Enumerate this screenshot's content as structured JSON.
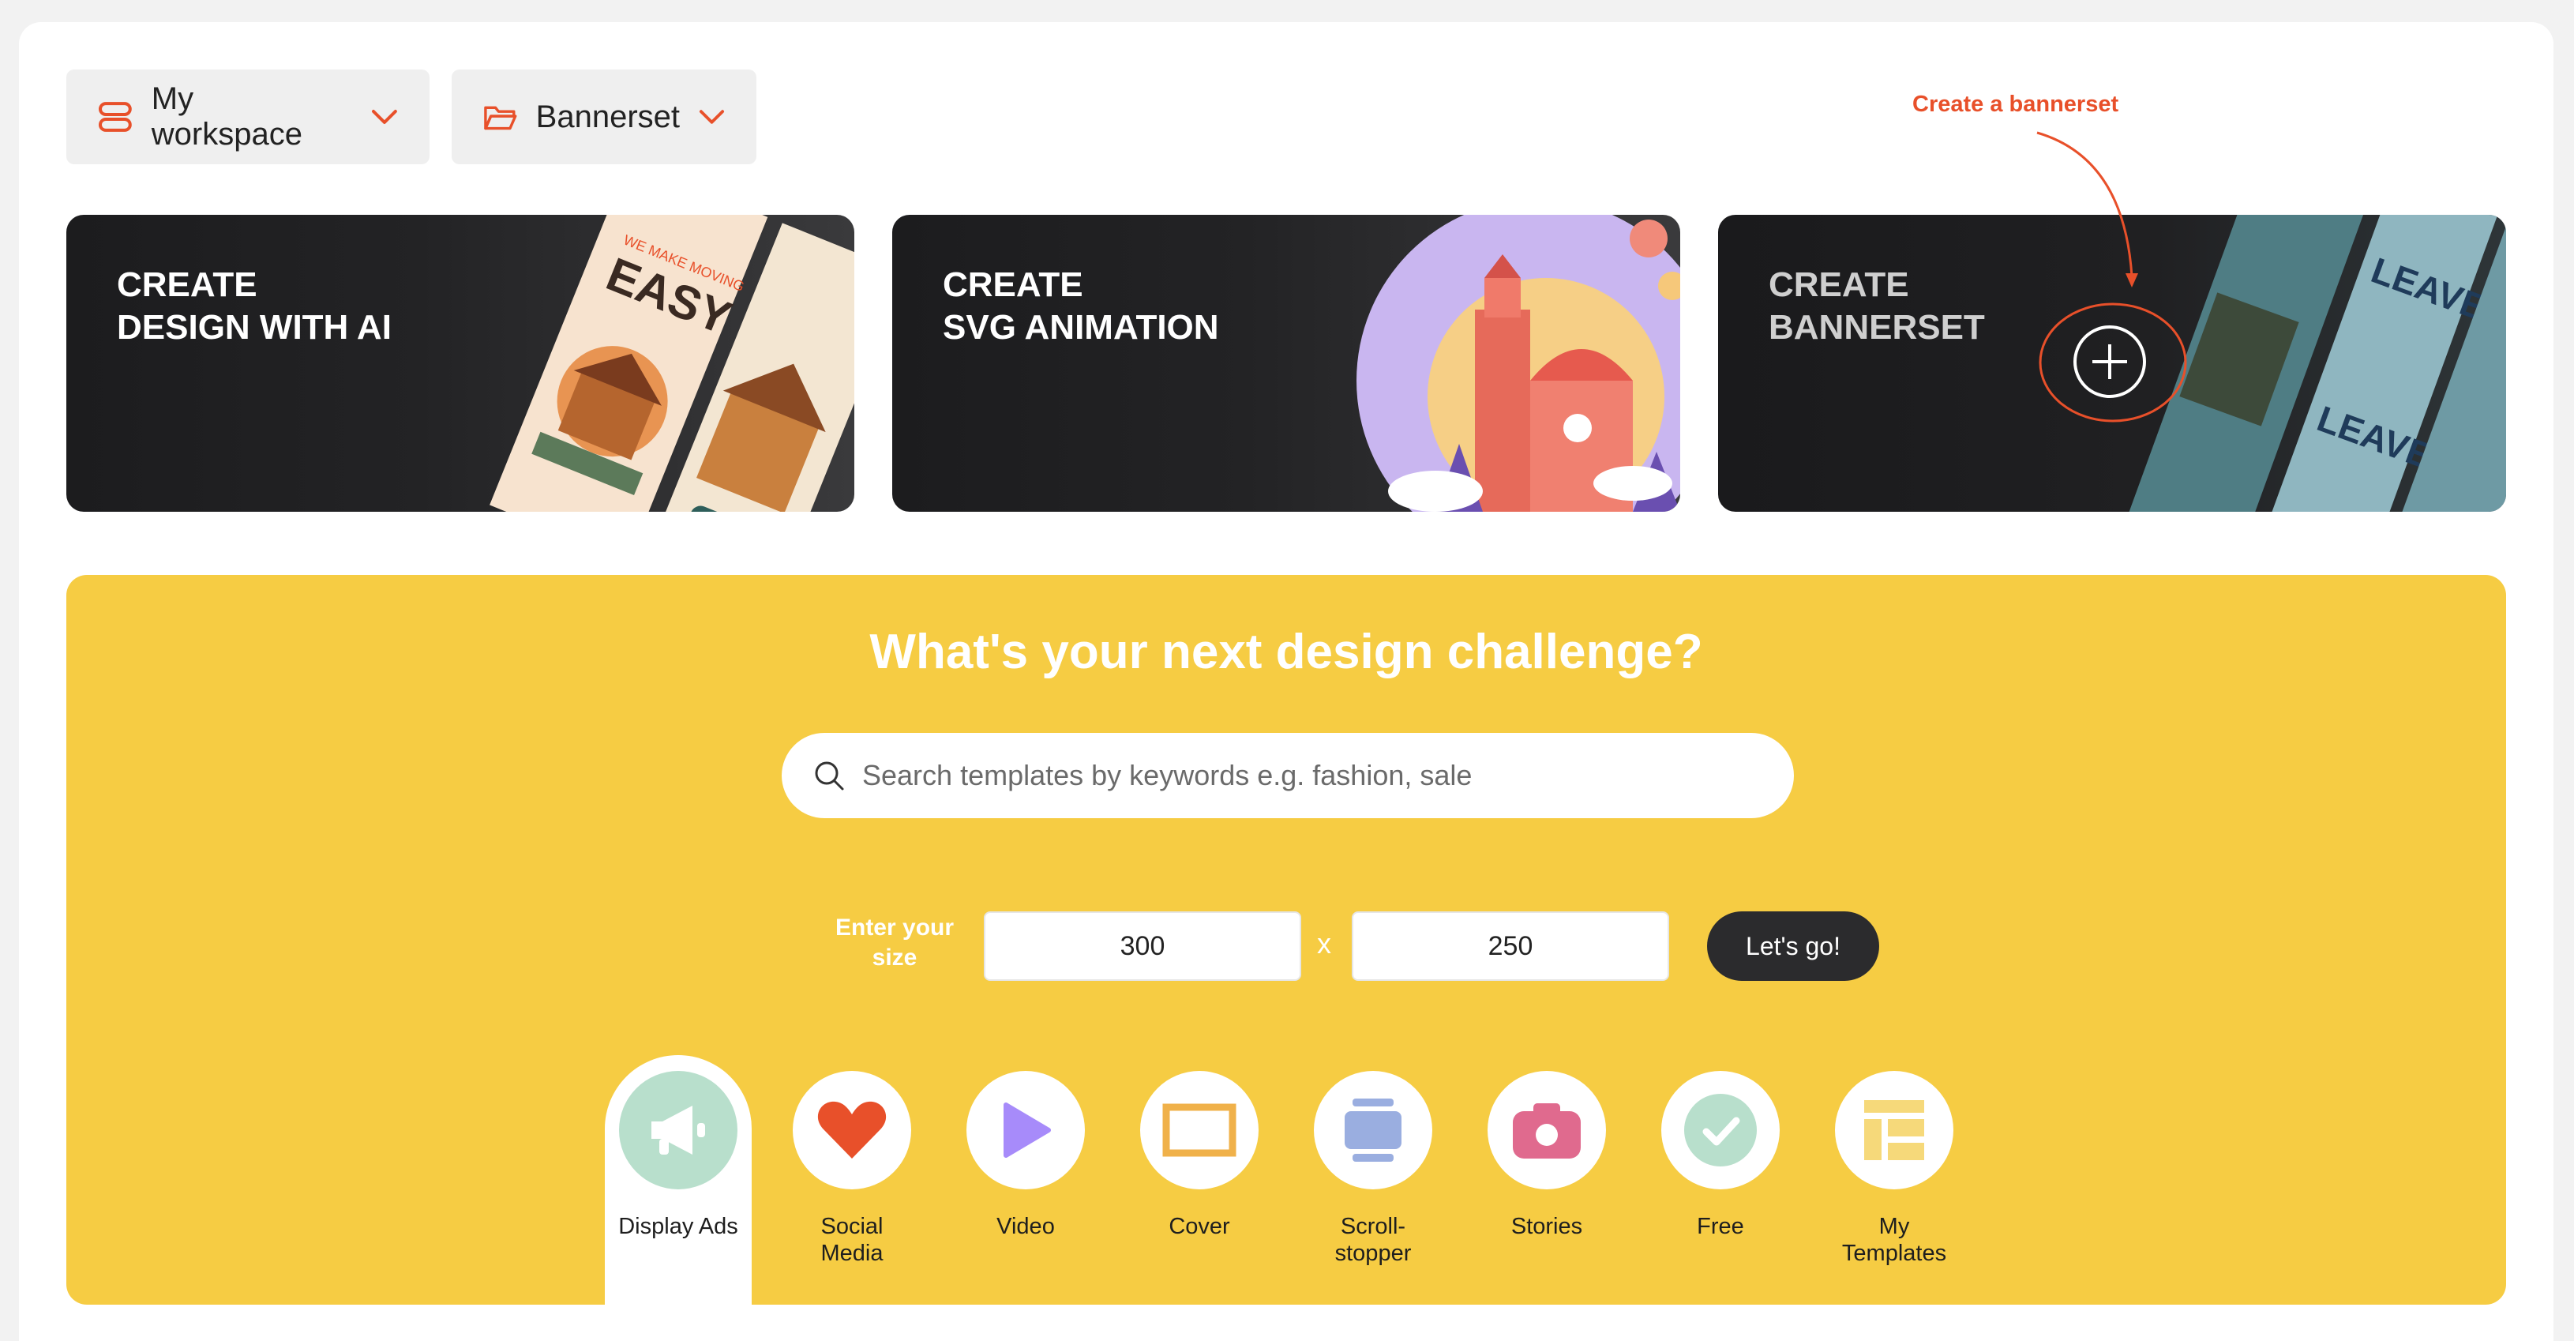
{
  "header": {
    "workspace_label": "My workspace",
    "bannerset_label": "Bannerset"
  },
  "cards": [
    {
      "line1": "CREATE",
      "line2": "DESIGN WITH AI"
    },
    {
      "line1": "CREATE",
      "line2": "SVG ANIMATION"
    },
    {
      "line1": "CREATE",
      "line2": "BANNERSET"
    }
  ],
  "annotation": {
    "text": "Create a bannerset"
  },
  "challenge": {
    "title": "What's your next design challenge?",
    "search_placeholder": "Search templates by keywords e.g. fashion, sale",
    "size_label_line1": "Enter your",
    "size_label_line2": "size",
    "width_value": "300",
    "height_value": "250",
    "separator": "x",
    "go_label": "Let's go!"
  },
  "categories": [
    {
      "line1": "Display Ads",
      "line2": "",
      "icon": "megaphone-icon",
      "color": "#b8dfcc"
    },
    {
      "line1": "Social",
      "line2": "Media",
      "icon": "heart-icon",
      "color": "#e8502a"
    },
    {
      "line1": "Video",
      "line2": "",
      "icon": "play-icon",
      "color": "#a78bfa"
    },
    {
      "line1": "Cover",
      "line2": "",
      "icon": "cover-icon",
      "color": "#f0b14a"
    },
    {
      "line1": "Scroll-",
      "line2": "stopper",
      "icon": "scroll-stopper-icon",
      "color": "#9aaee0"
    },
    {
      "line1": "Stories",
      "line2": "",
      "icon": "camera-icon",
      "color": "#e06a8e"
    },
    {
      "line1": "Free",
      "line2": "",
      "icon": "check-icon",
      "color": "#b8dfcc"
    },
    {
      "line1": "My",
      "line2": "Templates",
      "icon": "layout-icon",
      "color": "#f6d97a"
    }
  ],
  "colors": {
    "accent": "#e8502a",
    "challenge_bg": "#f6cc43",
    "dark": "#2b2b2d"
  }
}
